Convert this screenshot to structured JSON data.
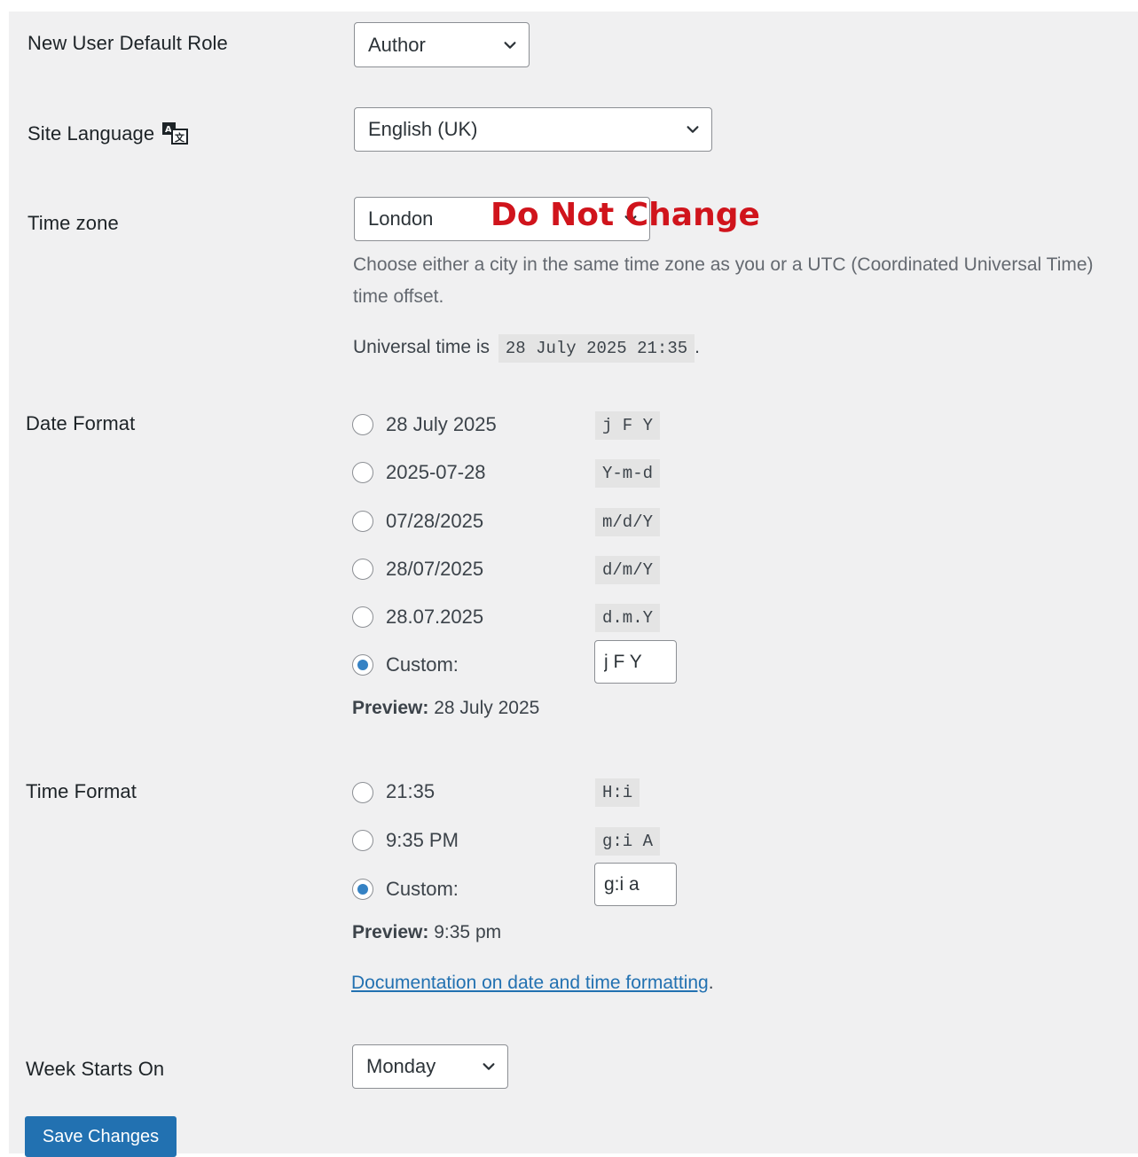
{
  "new_user_role": {
    "label": "New User Default Role",
    "value": "Author"
  },
  "site_language": {
    "label": "Site Language",
    "value": "English (UK)",
    "icon": "translation-icon"
  },
  "timezone": {
    "label": "Time zone",
    "value": "London",
    "annotation": "Do Not Change",
    "annotation_color": "#d0141c",
    "description": "Choose either a city in the same time zone as you or a UTC (Coordinated Universal Time) time offset.",
    "universal_prefix": "Universal time is",
    "universal_value": "28 July 2025 21:35",
    "universal_suffix": "."
  },
  "date_format": {
    "label": "Date Format",
    "options": [
      {
        "label": "28 July 2025",
        "code": "j F Y",
        "checked": false
      },
      {
        "label": "2025-07-28",
        "code": "Y-m-d",
        "checked": false
      },
      {
        "label": "07/28/2025",
        "code": "m/d/Y",
        "checked": false
      },
      {
        "label": "28/07/2025",
        "code": "d/m/Y",
        "checked": false
      },
      {
        "label": "28.07.2025",
        "code": "d.m.Y",
        "checked": false
      }
    ],
    "custom_label": "Custom:",
    "custom_value": "j F Y",
    "custom_checked": true,
    "preview_label": "Preview:",
    "preview_value": "28 July 2025"
  },
  "time_format": {
    "label": "Time Format",
    "options": [
      {
        "label": "21:35",
        "code": "H:i",
        "checked": false
      },
      {
        "label": "9:35 PM",
        "code": "g:i A",
        "checked": false
      }
    ],
    "custom_label": "Custom:",
    "custom_value": "g:i a",
    "custom_checked": true,
    "preview_label": "Preview:",
    "preview_value": "9:35 pm",
    "doc_link": "Documentation on date and time formatting",
    "doc_suffix": "."
  },
  "week_start": {
    "label": "Week Starts On",
    "value": "Monday"
  },
  "save_button": "Save Changes",
  "colors": {
    "accent": "#2271b1",
    "radio": "#3582c4",
    "background": "#f0f0f1"
  }
}
